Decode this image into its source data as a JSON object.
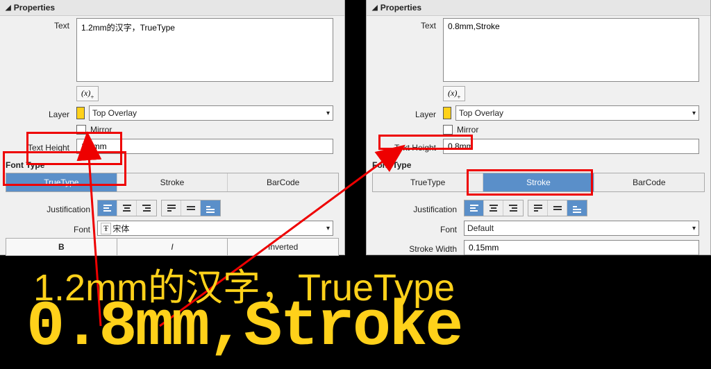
{
  "left": {
    "title": "Properties",
    "text_label": "Text",
    "text_value": "1.2mm的汉字，TrueType",
    "var_btn": "(x)+",
    "layer_label": "Layer",
    "layer_value": "Top Overlay",
    "layer_color": "#ffd11a",
    "mirror_label": "Mirror",
    "height_label": "Text Height",
    "height_value": "1.2mm",
    "fonttype_head": "Font Type",
    "tabs": {
      "truetype": "TrueType",
      "stroke": "Stroke",
      "barcode": "BarCode",
      "active": "truetype"
    },
    "just_label": "Justification",
    "font_label": "Font",
    "font_value": "宋体",
    "bold": "B",
    "italic": "I",
    "inverted": "Inverted"
  },
  "right": {
    "title": "Properties",
    "text_label": "Text",
    "text_value": "0.8mm,Stroke",
    "var_btn": "(x)+",
    "layer_label": "Layer",
    "layer_value": "Top Overlay",
    "layer_color": "#ffd11a",
    "mirror_label": "Mirror",
    "height_label": "Text Height",
    "height_value": "0.8mm",
    "fonttype_head": "Font Type",
    "tabs": {
      "truetype": "TrueType",
      "stroke": "Stroke",
      "barcode": "BarCode",
      "active": "stroke"
    },
    "just_label": "Justification",
    "font_label": "Font",
    "font_value": "Default",
    "sw_label": "Stroke Width",
    "sw_value": "0.15mm"
  },
  "preview": {
    "line1": "1.2mm的汉字，TrueType",
    "line2": "0.8mm,Stroke"
  }
}
